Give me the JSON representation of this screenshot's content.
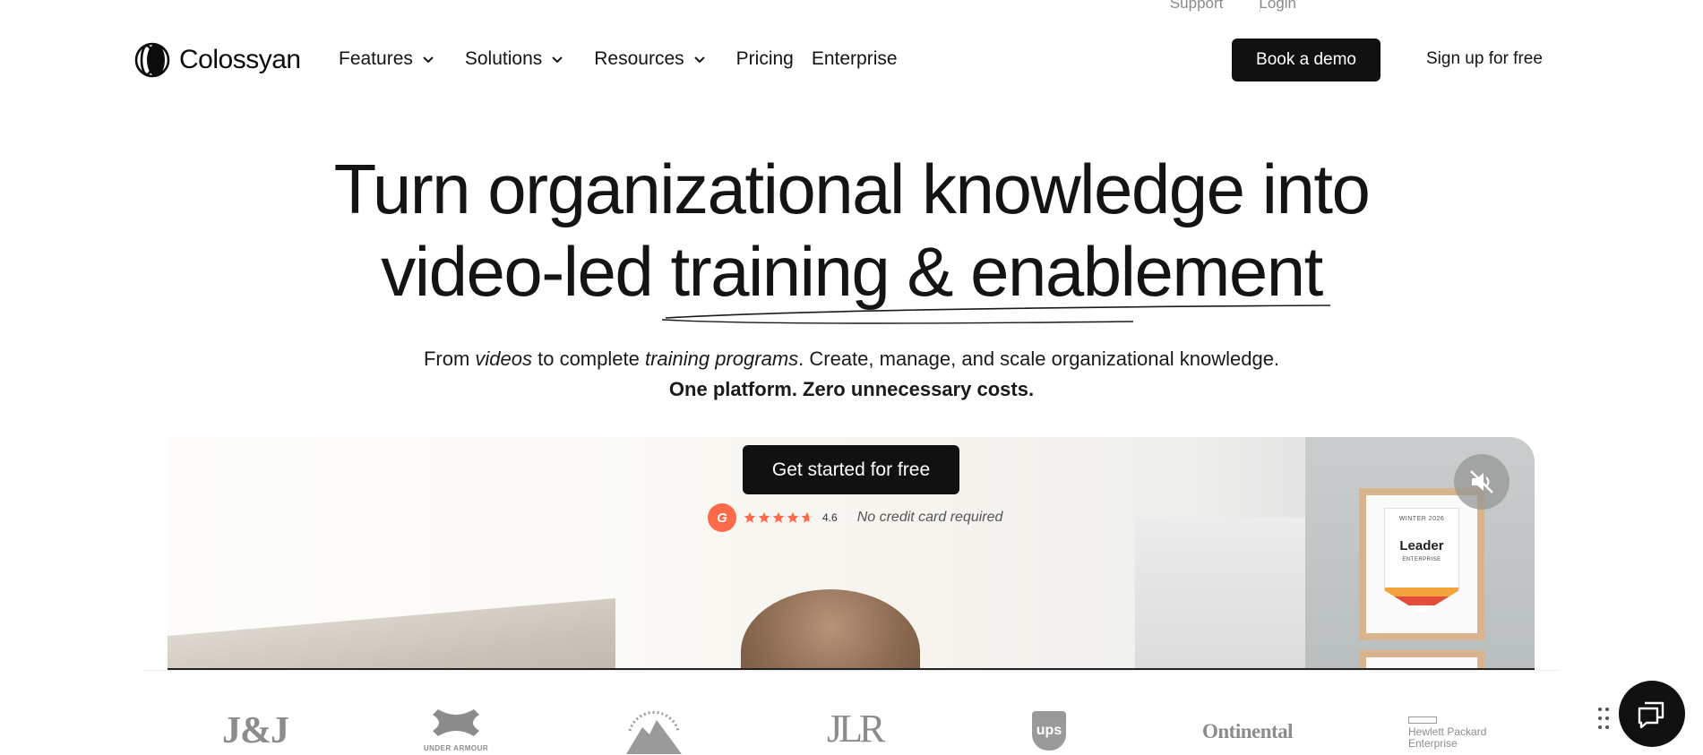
{
  "utility": {
    "support": "Support",
    "login": "Login"
  },
  "brand": {
    "name": "Colossyan"
  },
  "nav": {
    "features": "Features",
    "solutions": "Solutions",
    "resources": "Resources",
    "pricing": "Pricing",
    "enterprise": "Enterprise"
  },
  "header": {
    "demo_label": "Book a demo",
    "signup_label": "Sign up for free"
  },
  "hero": {
    "title_line1": "Turn organizational knowledge into",
    "title_line2": "video-led training & enablement",
    "sub_from": "From ",
    "sub_videos": "videos",
    "sub_to": " to complete ",
    "sub_programs": "training programs",
    "sub_rest": ". Create, manage, and scale organizational knowledge.",
    "sub_line2": "One platform. Zero unnecessary costs.",
    "cta_label": "Get started for free",
    "rating_value": "4.6",
    "no_card": "No credit card required",
    "g2_mark": "G"
  },
  "video": {
    "badge_season": "WINTER 2026",
    "badge_title": "Leader",
    "badge_segment": "ENTERPRISE"
  },
  "logos": {
    "jj": "J&J",
    "ua": "UNDER ARMOUR",
    "jlr": "JLR",
    "ups": "ups",
    "continental": "Ontinental",
    "hpe_line1": "Hewlett Packard",
    "hpe_line2": "Enterprise"
  },
  "colors": {
    "primary": "#111111",
    "g2": "#ff6a4a",
    "star": "#ff6a4a",
    "muted": "#8c8c8c"
  }
}
